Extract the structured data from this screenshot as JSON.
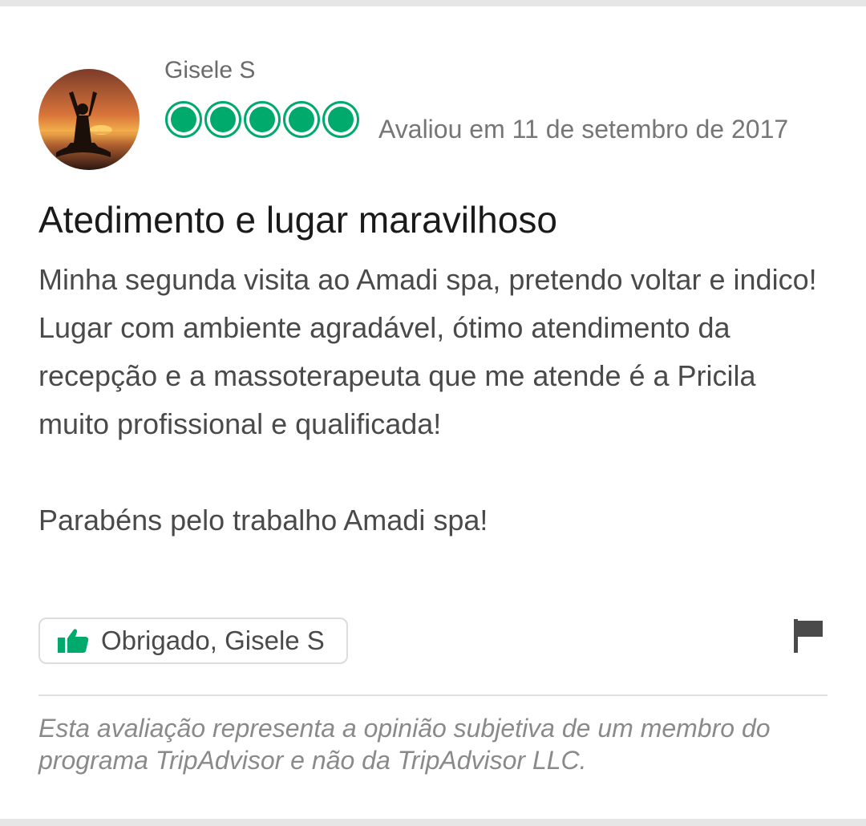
{
  "review": {
    "reviewer_name": "Gisele S",
    "rating": 5,
    "rating_max": 5,
    "date_text": "Avaliou em 11 de setembro de 2017",
    "title": "Atedimento e lugar maravilhoso",
    "body": {
      "line1": "Minha segunda visita ao Amadi spa, pretendo voltar e indico!",
      "line2": "Lugar com ambiente agradável, ótimo atendimento da recepção e a massoterapeuta que me atende é a Pricila muito profissional e qualificada!",
      "line3": "Parabéns pelo trabalho Amadi spa!"
    },
    "thanks_label": "Obrigado, Gisele S",
    "disclaimer": "Esta avaliação representa a opinião subjetiva de um membro do programa TripAdvisor e não da TripAdvisor LLC."
  },
  "icons": {
    "avatar": "avatar-yoga-sunset",
    "thanks": "thumbs-up-icon",
    "report": "flag-icon"
  },
  "colors": {
    "brand_green": "#00aa6c",
    "text_primary": "#1a1a1a",
    "text_secondary": "#4a4a4a",
    "text_muted": "#767676"
  }
}
